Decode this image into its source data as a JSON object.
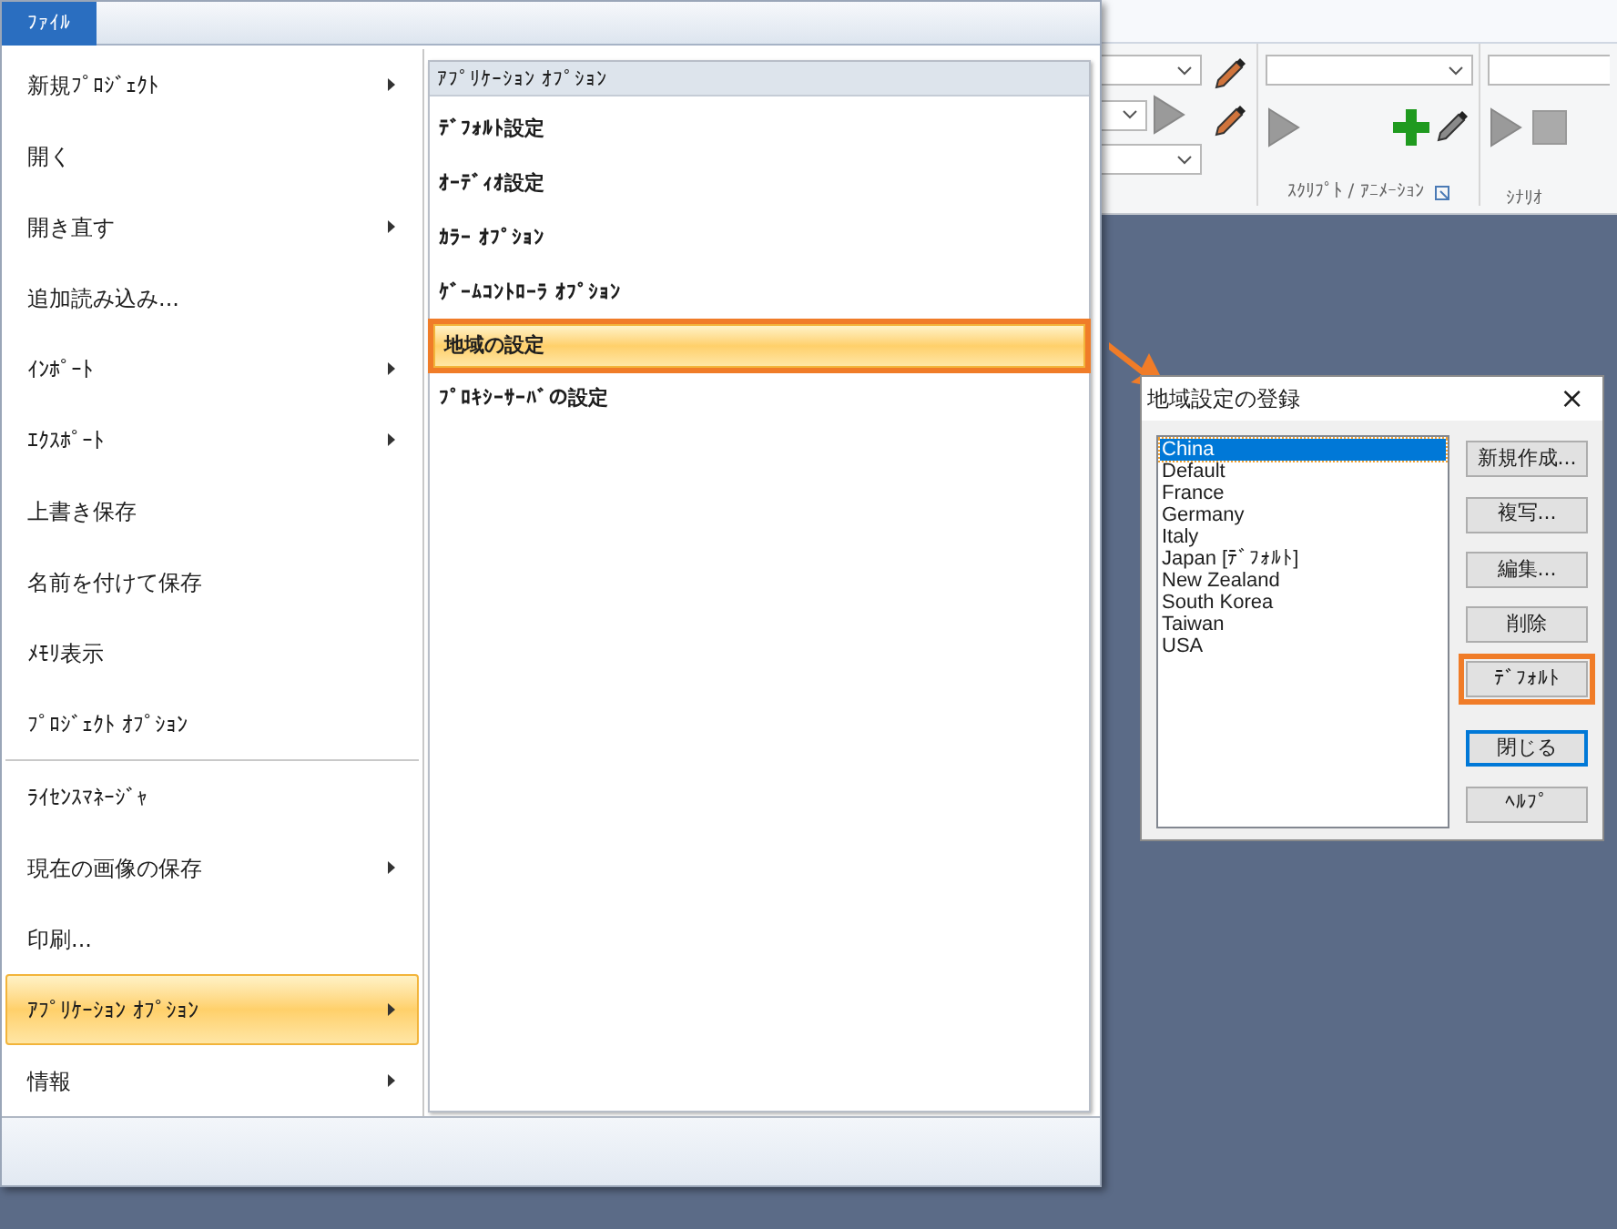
{
  "file_tab": {
    "label": "ﾌｧｲﾙ",
    "selected": true
  },
  "menu": {
    "items": [
      {
        "kind": "item",
        "label": "新規ﾌﾟﾛｼﾞｪｸﾄ",
        "submenu": true,
        "selected": false
      },
      {
        "kind": "item",
        "label": "開く",
        "submenu": false,
        "selected": false
      },
      {
        "kind": "item",
        "label": "開き直す",
        "submenu": true,
        "selected": false
      },
      {
        "kind": "item",
        "label": "追加読み込み...",
        "submenu": false,
        "selected": false
      },
      {
        "kind": "item",
        "label": "ｲﾝﾎﾟｰﾄ",
        "submenu": true,
        "selected": false
      },
      {
        "kind": "item",
        "label": "ｴｸｽﾎﾟｰﾄ",
        "submenu": true,
        "selected": false
      },
      {
        "kind": "item",
        "label": "上書き保存",
        "submenu": false,
        "selected": false
      },
      {
        "kind": "item",
        "label": "名前を付けて保存",
        "submenu": false,
        "selected": false
      },
      {
        "kind": "item",
        "label": "ﾒﾓﾘ表示",
        "submenu": false,
        "selected": false
      },
      {
        "kind": "item",
        "label": "ﾌﾟﾛｼﾞｪｸﾄ ｵﾌﾟｼｮﾝ",
        "submenu": false,
        "selected": false
      },
      {
        "kind": "separator"
      },
      {
        "kind": "item",
        "label": "ﾗｲｾﾝｽﾏﾈｰｼﾞｬ",
        "submenu": false,
        "selected": false
      },
      {
        "kind": "item",
        "label": "現在の画像の保存",
        "submenu": true,
        "selected": false
      },
      {
        "kind": "item",
        "label": "印刷...",
        "submenu": false,
        "selected": false
      },
      {
        "kind": "item",
        "label": "ｱﾌﾟﾘｹｰｼｮﾝ ｵﾌﾟｼｮﾝ",
        "submenu": true,
        "selected": true
      },
      {
        "kind": "item",
        "label": "情報",
        "submenu": true,
        "selected": false
      }
    ]
  },
  "submenu": {
    "header": "ｱﾌﾟﾘｹｰｼｮﾝ ｵﾌﾟｼｮﾝ",
    "items": [
      {
        "label": "ﾃﾞﾌｫﾙﾄ設定",
        "selected": false,
        "highlighted": false
      },
      {
        "label": "ｵｰﾃﾞｨｵ設定",
        "selected": false,
        "highlighted": false
      },
      {
        "label": "ｶﾗｰ ｵﾌﾟｼｮﾝ",
        "selected": false,
        "highlighted": false
      },
      {
        "label": "ｹﾞｰﾑｺﾝﾄﾛｰﾗ ｵﾌﾟｼｮﾝ",
        "selected": false,
        "highlighted": false
      },
      {
        "label": "地域の設定",
        "selected": true,
        "highlighted": true
      },
      {
        "label": "ﾌﾟﾛｷｼｰｻｰﾊﾞの設定",
        "selected": false,
        "highlighted": false
      }
    ]
  },
  "ribbon": {
    "groups": [
      {
        "label": "ｽｸﾘﾌﾟﾄ / ｱﾆﾒｰｼｮﾝ"
      },
      {
        "label": "ｼﾅﾘｵ"
      }
    ]
  },
  "dialog": {
    "title": "地域設定の登録",
    "close": "×",
    "regions": [
      {
        "label": "China",
        "selected": true
      },
      {
        "label": "Default",
        "selected": false
      },
      {
        "label": "France",
        "selected": false
      },
      {
        "label": "Germany",
        "selected": false
      },
      {
        "label": "Italy",
        "selected": false
      },
      {
        "label": "Japan [ﾃﾞﾌｫﾙﾄ]",
        "selected": false
      },
      {
        "label": "New Zealand",
        "selected": false
      },
      {
        "label": "South Korea",
        "selected": false
      },
      {
        "label": "Taiwan",
        "selected": false
      },
      {
        "label": "USA",
        "selected": false
      }
    ],
    "buttons": [
      {
        "label": "新規作成...",
        "highlighted": false,
        "default": false
      },
      {
        "label": "複写...",
        "highlighted": false,
        "default": false
      },
      {
        "label": "編集...",
        "highlighted": false,
        "default": false
      },
      {
        "label": "削除",
        "highlighted": false,
        "default": false
      },
      {
        "label": "ﾃﾞﾌｫﾙﾄ",
        "highlighted": true,
        "default": false
      },
      {
        "label": "閉じる",
        "highlighted": false,
        "default": true
      },
      {
        "label": "ﾍﾙﾌﾟ",
        "highlighted": false,
        "default": false
      }
    ]
  }
}
